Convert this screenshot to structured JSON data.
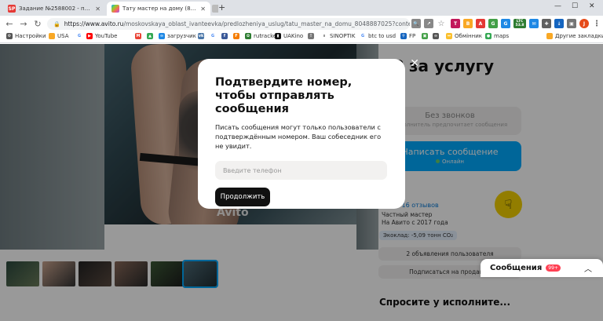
{
  "browser": {
    "tabs": [
      {
        "label": "Задание №2588002 - просмотр з",
        "favicon": "SP"
      },
      {
        "label": "Тату мастер на дому (80488870251)",
        "favicon": "avito"
      },
      {
        "label": "",
        "favicon": "blank"
      }
    ],
    "url_host": "https://www.avito.ru",
    "url_path": "/moskovskaya_oblast_ivanteevka/predlozheniya_uslug/tatu_master_na_domu_8048887025?context=H4...",
    "ext_badge": "LTC 53.8",
    "bookmarks": [
      "Настройки",
      "USA",
      "YouTube",
      "загрузчик",
      "rutracker",
      "UAKino",
      "SINOPTIK",
      "btc to usd",
      "FP",
      "Обмінник",
      "maps"
    ],
    "other_bookmarks": "Другие закладки"
  },
  "page": {
    "title": "₽ за услугу",
    "watermark": "Avito",
    "btn_no_calls": "Без звонков",
    "btn_no_calls_sub": "Исполнитель предпочитает сообщения",
    "btn_write": "Написать сообщение",
    "btn_write_sub": "Онлайн",
    "rating_stars": "★★★",
    "reviews": "16 отзывов",
    "seller_role": "Частный мастер",
    "seller_since": "На Авито с 2017 года",
    "eco": "Экоклад: -5,09 тонн CO₂",
    "user_ads": "2 объявления пользователя",
    "subscribe": "Подписаться на продавца",
    "ask": "Спросите у исполните...",
    "messages": "Сообщения",
    "messages_badge": "99+"
  },
  "modal": {
    "heading": "Подтвердите номер, чтобы отправлять сообщения",
    "text": "Писать сообщения могут только пользователи с подтверждённым номером. Ваш собеседник его не увидит.",
    "phone_placeholder": "Введите телефон",
    "continue": "Продолжить"
  },
  "colors": {
    "accent": "#00aaff",
    "dark_button": "#111111",
    "badge": "#ff4053"
  }
}
